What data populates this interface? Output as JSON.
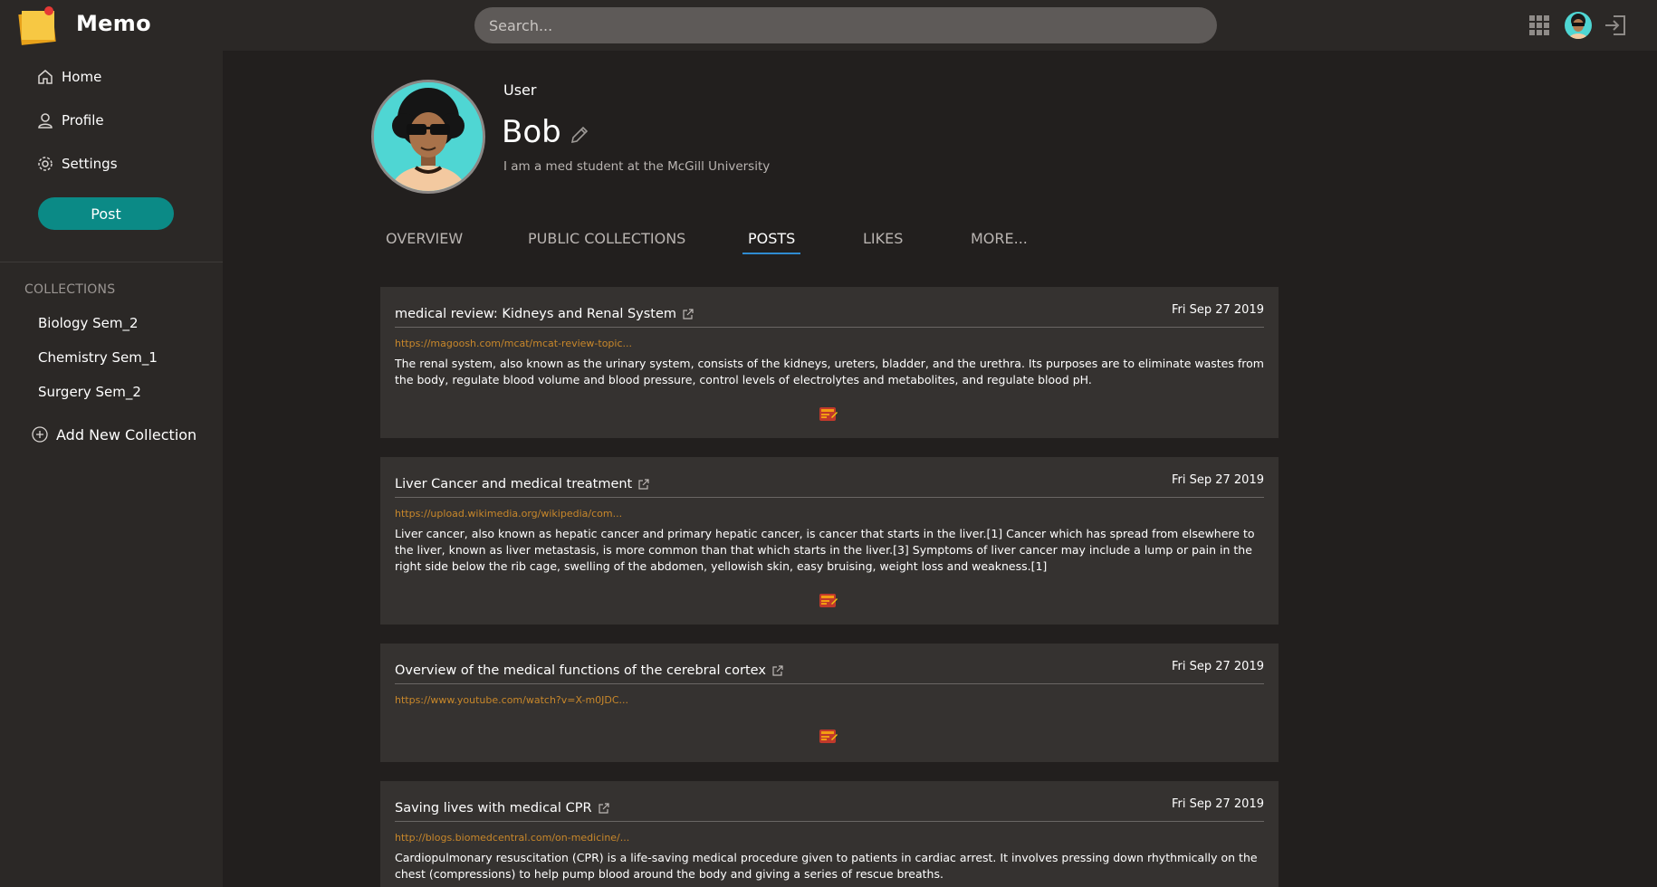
{
  "app": {
    "name": "Memo"
  },
  "search": {
    "placeholder": "Search..."
  },
  "sidebar": {
    "nav": [
      {
        "label": "Home",
        "icon": "home-icon"
      },
      {
        "label": "Profile",
        "icon": "user-icon"
      },
      {
        "label": "Settings",
        "icon": "gear-icon"
      }
    ],
    "post_label": "Post",
    "collections_title": "COLLECTIONS",
    "collections": [
      "Biology Sem_2",
      "Chemistry Sem_1",
      "Surgery Sem_2"
    ],
    "add_collection_label": "Add New Collection"
  },
  "profile": {
    "role": "User",
    "name": "Bob",
    "bio": "I am a med student at the McGill University"
  },
  "tabs": [
    {
      "label": "OVERVIEW",
      "active": false
    },
    {
      "label": "PUBLIC COLLECTIONS",
      "active": false
    },
    {
      "label": "POSTS",
      "active": true
    },
    {
      "label": "LIKES",
      "active": false
    },
    {
      "label": "MORE...",
      "active": false
    }
  ],
  "posts": [
    {
      "title": "medical review: Kidneys and Renal System",
      "date": "Fri Sep 27 2019",
      "url": "https://magoosh.com/mcat/mcat-review-topic...",
      "body": "The renal system, also known as the urinary system, consists of the kidneys, ureters, bladder, and the urethra. Its purposes are to eliminate wastes from the body, regulate blood volume and blood pressure, control levels of electrolytes and metabolites, and regulate blood pH."
    },
    {
      "title": "Liver Cancer and medical treatment",
      "date": "Fri Sep 27 2019",
      "url": "https://upload.wikimedia.org/wikipedia/com...",
      "body": "Liver cancer, also known as hepatic cancer and primary hepatic cancer, is cancer that starts in the liver.[1] Cancer which has spread from elsewhere to the liver, known as liver metastasis, is more common than that which starts in the liver.[3] Symptoms of liver cancer may include a lump or pain in the right side below the rib cage, swelling of the abdomen, yellowish skin, easy bruising, weight loss and weakness.[1]"
    },
    {
      "title": "Overview of the medical functions of the cerebral cortex",
      "date": "Fri Sep 27 2019",
      "url": "https://www.youtube.com/watch?v=X-m0JDC...",
      "body": ""
    },
    {
      "title": "Saving lives with medical CPR",
      "date": "Fri Sep 27 2019",
      "url": "http://blogs.biomedcentral.com/on-medicine/...",
      "body": "Cardiopulmonary resuscitation (CPR) is a life-saving medical procedure given to patients in cardiac arrest. It involves pressing down rhythmically on the chest (compressions) to help pump blood around the body and giving a series of rescue breaths."
    }
  ],
  "colors": {
    "background": "#221f1e",
    "panel": "#2b2826",
    "card": "#353230",
    "accent": "#0b8a86",
    "link": "#c8872a",
    "tab_underline": "#2f8bd1"
  }
}
